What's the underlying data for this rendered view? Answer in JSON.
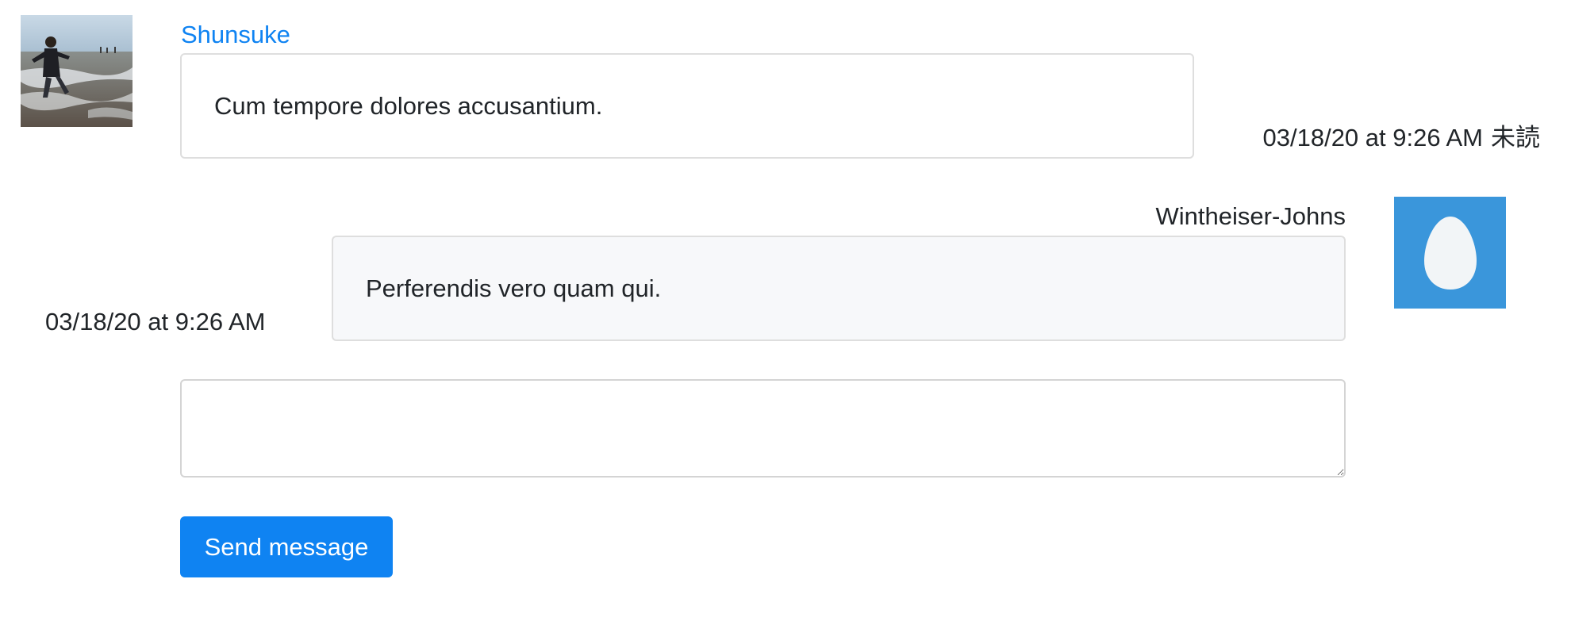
{
  "messages": [
    {
      "sender": "Shunsuke",
      "text": "Cum tempore dolores accusantium.",
      "timestamp": "03/18/20 at 9:26 AM",
      "status": "未読",
      "avatar": "user-photo"
    },
    {
      "sender": "Wintheiser-Johns",
      "text": "Perferendis vero quam qui.",
      "timestamp": "03/18/20 at 9:26 AM",
      "avatar": "default-egg-avatar"
    }
  ],
  "composer": {
    "value": "",
    "send_label": "Send message"
  },
  "colors": {
    "link": "#0f83f2",
    "button": "#0f83f2",
    "egg_background": "#3a96db",
    "sent_bubble": "#f7f8fa"
  }
}
